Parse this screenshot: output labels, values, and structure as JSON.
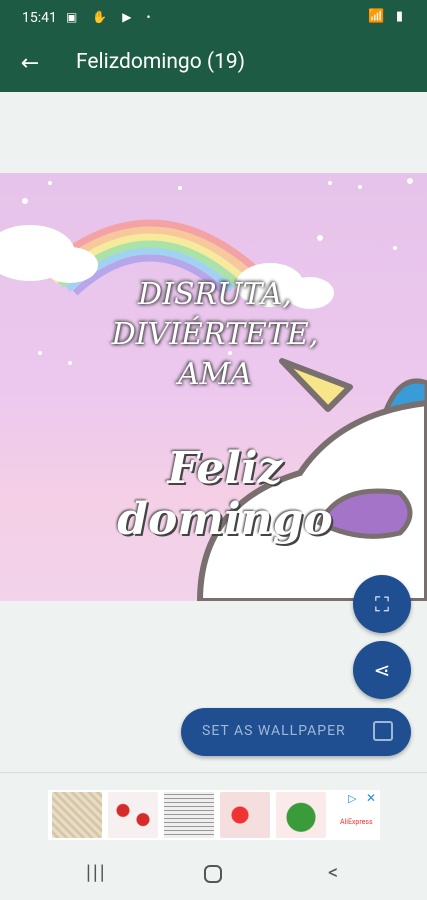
{
  "status_bar": {
    "time": "15:41",
    "left_icons": "▣ ✋ ▶ •",
    "system_icons": "📶 ▮"
  },
  "app_bar": {
    "back_icon": "←",
    "title": "Felizdomingo (19)"
  },
  "image": {
    "line1": "DISRUTA,",
    "line2": "DIVIÉRTETE,",
    "line3": "AMA",
    "line4": "Feliz domingo"
  },
  "actions": {
    "fullscreen_icon": "⛶",
    "share_icon": "⋖",
    "wallpaper_label": "SET AS WALLPAPER"
  },
  "ad": {
    "brand": "AliExpress",
    "adchoices_icon": "▷",
    "close_icon": "✕"
  },
  "nav": {
    "recents_icon": "|||",
    "back_icon": "<"
  }
}
